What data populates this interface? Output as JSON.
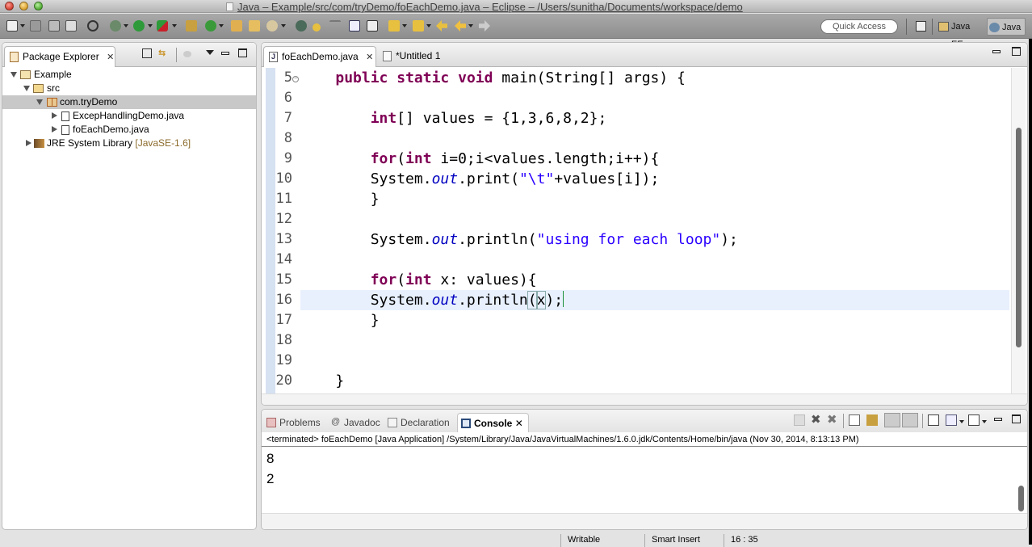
{
  "window": {
    "title": "Java – Example/src/com/tryDemo/foEachDemo.java – Eclipse – /Users/sunitha/Documents/workspace/demo"
  },
  "toolbar": {
    "quick_access_label": "Quick Access",
    "perspectives": [
      {
        "label": "Java EE",
        "active": false
      },
      {
        "label": "Java",
        "active": true
      }
    ],
    "icons": [
      "new-icon",
      "save-icon",
      "save-all-icon",
      "print-icon",
      "skip-breakpoints-icon",
      "debug-icon",
      "run-icon",
      "run-external-icon",
      "new-java-project-icon",
      "new-class-icon",
      "open-type-icon",
      "open-task-icon",
      "search-icon",
      "open-declaration-icon",
      "toggle-mark-occurrences-icon",
      "ant-icon",
      "show-whitespace-icon",
      "toggle-block-selection-icon",
      "next-annotation-icon",
      "previous-annotation-icon",
      "last-edit-icon",
      "back-icon",
      "forward-icon"
    ]
  },
  "package_explorer": {
    "title": "Package Explorer",
    "tree": [
      {
        "label": "Example",
        "type": "project",
        "expanded": true,
        "depth": 0
      },
      {
        "label": "src",
        "type": "source-folder",
        "expanded": true,
        "depth": 1
      },
      {
        "label": "com.tryDemo",
        "type": "package",
        "expanded": true,
        "depth": 2,
        "selected": true
      },
      {
        "label": "ExcepHandlingDemo.java",
        "type": "java-file",
        "expanded": false,
        "depth": 3
      },
      {
        "label": "foEachDemo.java",
        "type": "java-file",
        "expanded": false,
        "depth": 3
      },
      {
        "label": "JRE System Library",
        "suffix": "[JavaSE-1.6]",
        "type": "library",
        "expanded": false,
        "depth": 1
      }
    ]
  },
  "editor": {
    "tabs": [
      {
        "label": "foEachDemo.java",
        "active": true,
        "dirty": false
      },
      {
        "label": "*Untitled 1",
        "active": false,
        "dirty": true
      }
    ],
    "lines": [
      {
        "num": "5",
        "fold": true,
        "text": "    public static void main(String[] args) {"
      },
      {
        "num": "6",
        "text": ""
      },
      {
        "num": "7",
        "text": "        int[] values = {1,3,6,8,2};"
      },
      {
        "num": "8",
        "text": ""
      },
      {
        "num": "9",
        "text": "        for(int i=0;i<values.length;i++){"
      },
      {
        "num": "10",
        "text": "        System.out.print(\"\\t\"+values[i]);"
      },
      {
        "num": "11",
        "text": "        }"
      },
      {
        "num": "12",
        "text": ""
      },
      {
        "num": "13",
        "text": "        System.out.println(\"using for each loop\");"
      },
      {
        "num": "14",
        "text": ""
      },
      {
        "num": "15",
        "text": "        for(int x: values){"
      },
      {
        "num": "16",
        "text": "        System.out.println(x);",
        "current": true
      },
      {
        "num": "17",
        "text": "        }"
      },
      {
        "num": "18",
        "text": ""
      },
      {
        "num": "19",
        "text": ""
      },
      {
        "num": "20",
        "text": "    }"
      }
    ],
    "tokens": {
      "l5": {
        "indent": "    ",
        "kw1": "public",
        "kw2": "static",
        "kw3": "void",
        "rest": " main(String[] args) {"
      },
      "l7": {
        "indent": "        ",
        "kw": "int",
        "rest": "[] values = {1,3,6,8,2};"
      },
      "l9": {
        "indent": "        ",
        "kw1": "for",
        "p1": "(",
        "kw2": "int",
        "rest": " i=0;i<values.length;i++){"
      },
      "l10": {
        "indent": "        ",
        "pre": "System.",
        "field": "out",
        "mid": ".print(",
        "str": "\"\\t\"",
        "rest": "+values[i]);"
      },
      "l11": {
        "indent": "        ",
        "rest": "}"
      },
      "l13": {
        "indent": "        ",
        "pre": "System.",
        "field": "out",
        "mid": ".println(",
        "str": "\"using for each loop\"",
        "rest": ");"
      },
      "l15": {
        "indent": "        ",
        "kw1": "for",
        "p1": "(",
        "kw2": "int",
        "rest": " x: values){"
      },
      "l16": {
        "indent": "        ",
        "pre": "System.",
        "field": "out",
        "mid": ".println",
        "open": "(",
        "arg": "x",
        "rest": ");"
      },
      "l17": {
        "indent": "        ",
        "rest": "}"
      },
      "l20": {
        "indent": "    ",
        "rest": "}"
      }
    }
  },
  "console": {
    "tabs": [
      {
        "label": "Problems",
        "active": false
      },
      {
        "label": "Javadoc",
        "active": false
      },
      {
        "label": "Declaration",
        "active": false
      },
      {
        "label": "Console",
        "active": true
      }
    ],
    "status": "<terminated> foEachDemo [Java Application] /System/Library/Java/JavaVirtualMachines/1.6.0.jdk/Contents/Home/bin/java (Nov 30, 2014, 8:13:13 PM)",
    "output_lines": [
      "8",
      "2"
    ],
    "toolbar_icons": [
      "terminate-icon",
      "remove-launch-icon",
      "remove-all-terminated-icon",
      "clear-console-icon",
      "scroll-lock-icon",
      "show-on-stdout-icon",
      "show-on-stderr-icon",
      "pin-console-icon",
      "display-selected-console-icon",
      "open-console-icon"
    ]
  },
  "statusbar": {
    "writable": "Writable",
    "insert_mode": "Smart Insert",
    "cursor_position": "16 : 35"
  }
}
